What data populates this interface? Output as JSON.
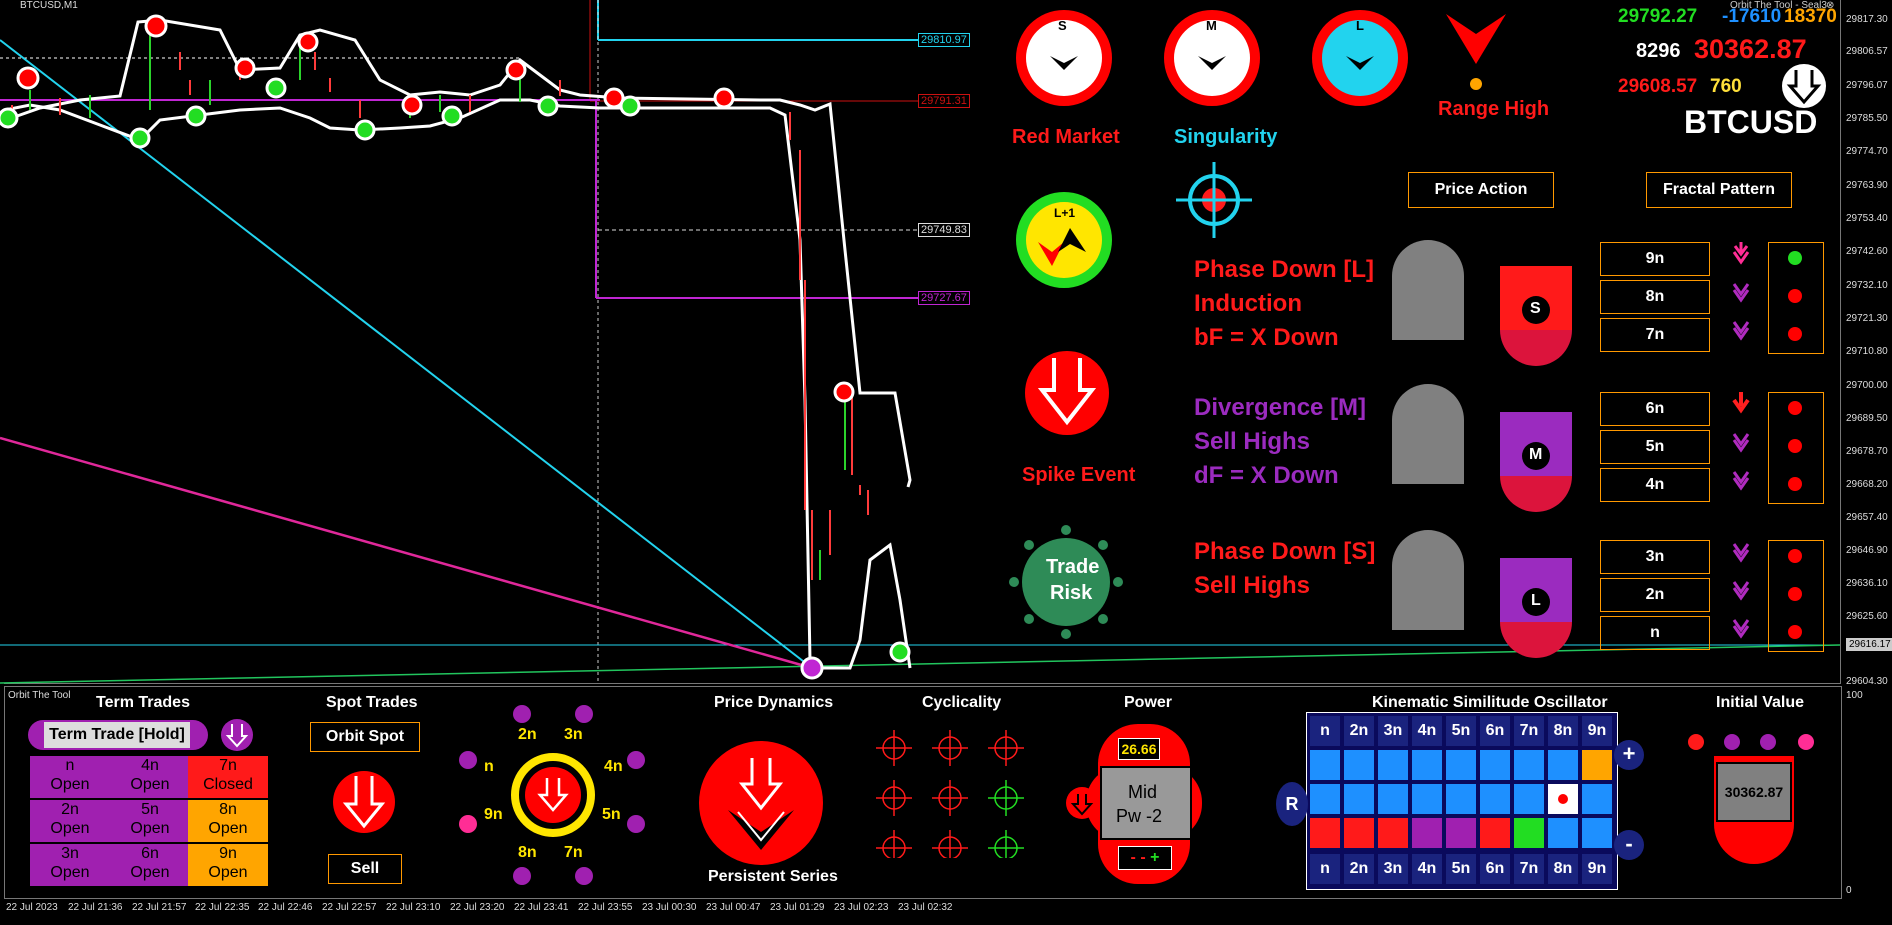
{
  "window": {
    "symbol_label": "BTCUSD,M1",
    "indicator_name": "Orbit The Tool - Seal3"
  },
  "price_axis": [
    "29817.30",
    "29806.57",
    "29796.07",
    "29785.50",
    "29774.70",
    "29763.90",
    "29753.40",
    "29742.60",
    "29732.10",
    "29721.30",
    "29710.80",
    "29700.00",
    "29689.50",
    "29678.70",
    "29668.20",
    "29657.40",
    "29646.90",
    "29636.10",
    "29625.60",
    "29616.17",
    "29604.30"
  ],
  "sub_axis": [
    "100",
    "0"
  ],
  "time_axis": [
    "22 Jul 2023",
    "22 Jul 21:36",
    "22 Jul 21:57",
    "22 Jul 22:35",
    "22 Jul 22:46",
    "22 Jul 22:57",
    "22 Jul 23:10",
    "22 Jul 23:20",
    "22 Jul 23:41",
    "22 Jul 23:55",
    "23 Jul 00:30",
    "23 Jul 00:47",
    "23 Jul 01:29",
    "23 Jul 02:23",
    "23 Jul 02:32"
  ],
  "price_tags": {
    "cyan": "29810.97",
    "red": "29791.31",
    "white": "29749.83",
    "magenta": "29727.67",
    "current": "29616.17"
  },
  "stats": {
    "green_val": "29792.27",
    "blue_val": "-17610",
    "orange_val": "18370",
    "white_val": "8296",
    "red_big": "30362.87",
    "red_small": "29608.57",
    "yellow_val": "760",
    "symbol": "BTCUSD"
  },
  "dials": [
    {
      "letter": "S",
      "color": "#ffffff"
    },
    {
      "letter": "M",
      "color": "#ffffff"
    },
    {
      "letter": "L",
      "color": "#22d3ee"
    }
  ],
  "labels": {
    "red_market": "Red Market",
    "singularity": "Singularity",
    "range_high": "Range High",
    "spike_event": "Spike Event",
    "trade_risk_1": "Trade",
    "trade_risk_2": "Risk",
    "lp1": "L+1"
  },
  "buttons": {
    "price_action": "Price Action",
    "fractal_pattern": "Fractal Pattern"
  },
  "phases": [
    {
      "lines": [
        "Phase Down [L]",
        "Induction",
        "bF = X Down"
      ],
      "color": "#ff1a1a",
      "badge": "S"
    },
    {
      "lines": [
        "Divergence [M]",
        "Sell Highs",
        "dF = X Down"
      ],
      "color": "#9b2bbf",
      "badge": "M"
    },
    {
      "lines": [
        "Phase Down [S]",
        "Sell Highs"
      ],
      "color": "#ff1a1a",
      "badge": "L"
    }
  ],
  "n_boxes": [
    "9n",
    "8n",
    "7n",
    "6n",
    "5n",
    "4n",
    "3n",
    "2n",
    "n"
  ],
  "n_arrows": [
    "#ff2d95",
    "#b02bbf",
    "#b02bbf",
    "#ff2020",
    "#b02bbf",
    "#b02bbf",
    "#b02bbf",
    "#b02bbf",
    "#b02bbf"
  ],
  "n_dots": [
    "#22dd22",
    "#ff0000",
    "#ff0000",
    "#ff0000",
    "#ff0000",
    "#ff0000",
    "#ff0000",
    "#ff0000",
    "#ff0000"
  ],
  "sub": {
    "indicator_label": "Orbit The Tool",
    "term_trades": "Term Trades",
    "term_trade_hold": "Term Trade [Hold]",
    "tt_cells": [
      {
        "top": "n",
        "bottom": "Open",
        "color": "#a020b0"
      },
      {
        "top": "4n",
        "bottom": "Open",
        "color": "#a020b0"
      },
      {
        "top": "7n",
        "bottom": "Closed",
        "color": "#ff1a1a"
      },
      {
        "top": "2n",
        "bottom": "Open",
        "color": "#a020b0"
      },
      {
        "top": "5n",
        "bottom": "Open",
        "color": "#a020b0"
      },
      {
        "top": "8n",
        "bottom": "Open",
        "color": "#ffa500"
      },
      {
        "top": "3n",
        "bottom": "Open",
        "color": "#a020b0"
      },
      {
        "top": "6n",
        "bottom": "Open",
        "color": "#a020b0"
      },
      {
        "top": "9n",
        "bottom": "Open",
        "color": "#ffa500"
      }
    ],
    "spot_trades": "Spot Trades",
    "orbit_spot": "Orbit Spot",
    "sell": "Sell",
    "orbit_labels": {
      "top_left": "2n",
      "top_right": "3n",
      "left": "n",
      "right": "4n",
      "bl": "9n",
      "br": "5n",
      "bot_left": "8n",
      "bot_right": "7n"
    },
    "price_dynamics": "Price Dynamics",
    "persistent_series": "Persistent Series",
    "cyclicality": "Cyclicality",
    "power": "Power",
    "power_value": "26.66",
    "power_mid": "Mid",
    "power_pw": "Pw -2",
    "kso_title": "Kinematic Similitude Oscillator",
    "kso_headers": [
      "n",
      "2n",
      "3n",
      "4n",
      "5n",
      "6n",
      "7n",
      "8n",
      "9n"
    ],
    "kso_row1": [
      "#1e90ff",
      "#1e90ff",
      "#1e90ff",
      "#1e90ff",
      "#1e90ff",
      "#1e90ff",
      "#1e90ff",
      "#1e90ff",
      "#ffa500"
    ],
    "kso_row2": [
      "#1e90ff",
      "#1e90ff",
      "#1e90ff",
      "#1e90ff",
      "#1e90ff",
      "#1e90ff",
      "#1e90ff",
      "#ffffff",
      "#1e90ff"
    ],
    "kso_row3": [
      "#ff1a1a",
      "#ff1a1a",
      "#ff1a1a",
      "#a020b0",
      "#a020b0",
      "#ff1a1a",
      "#22dd22",
      "#1e90ff",
      "#1e90ff"
    ],
    "kso_plus": "+",
    "kso_minus": "-",
    "kso_r": "R",
    "initial_value": "Initial Value",
    "initial_value_num": "30362.87"
  }
}
